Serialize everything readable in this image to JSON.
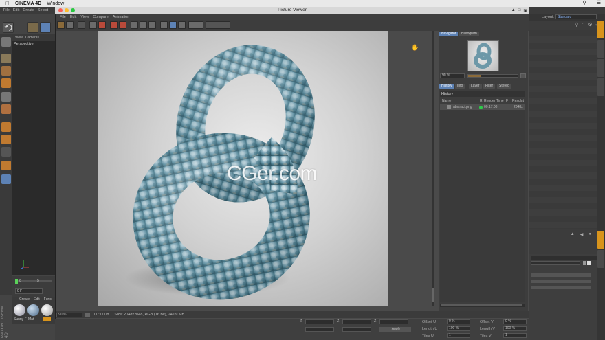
{
  "macbar": {
    "apple": "",
    "app_name": "CINEMA 4D",
    "window_menu": "Window"
  },
  "c4d": {
    "menu": [
      "File",
      "Edit",
      "Create",
      "Select"
    ],
    "viewport_menu": [
      "View",
      "Cameras"
    ],
    "viewport_label": "Perspective",
    "timeline": {
      "frame_start": "0",
      "frame_mark": "5",
      "current_frame": "0 F"
    },
    "material_menu": [
      "Create",
      "Edit",
      "Func"
    ],
    "materials": [
      "Sunny F",
      "Mat",
      ""
    ],
    "maxon_logo": "MAXON CINEMA 4D",
    "layout_label": "Layout:",
    "layout_value": "Standard"
  },
  "picture_viewer": {
    "title": "Picture Viewer",
    "menu": [
      "File",
      "Edit",
      "View",
      "Compare",
      "Animation"
    ],
    "zoom": "90 %",
    "status_time": "00:17:08",
    "status_info": "Size: 2048x2048, RGB (16 Bit), 24.09 MB",
    "watermark": "CGer.com"
  },
  "navigator": {
    "tabs": [
      "Navigator",
      "Histogram"
    ],
    "zoom": "90 %",
    "slider_fraction": 0.25
  },
  "history": {
    "tabs": [
      "History",
      "Info",
      "Layer",
      "Filter",
      "Stereo"
    ],
    "title": "History",
    "columns": [
      "Name",
      "R",
      "Render Time",
      "F",
      "Resolut"
    ],
    "rows": [
      {
        "name": "abstract.png",
        "render_time": "00:17:08",
        "resolution": "2048x"
      }
    ]
  },
  "attributes": {
    "coords_labels": [
      "Z",
      "Z",
      "Z"
    ],
    "apply_label": "Apply",
    "fields": [
      {
        "label": "Offset U",
        "value": "0 %"
      },
      {
        "label": "Offset V",
        "value": "0 %"
      },
      {
        "label": "Length U",
        "value": "100 %"
      },
      {
        "label": "Length V",
        "value": "100 %"
      },
      {
        "label": "Tiles U",
        "value": "1"
      },
      {
        "label": "Tiles V",
        "value": "1"
      }
    ]
  },
  "colors": {
    "accent": "#5d82b5",
    "status_green": "#2ecc4a"
  }
}
